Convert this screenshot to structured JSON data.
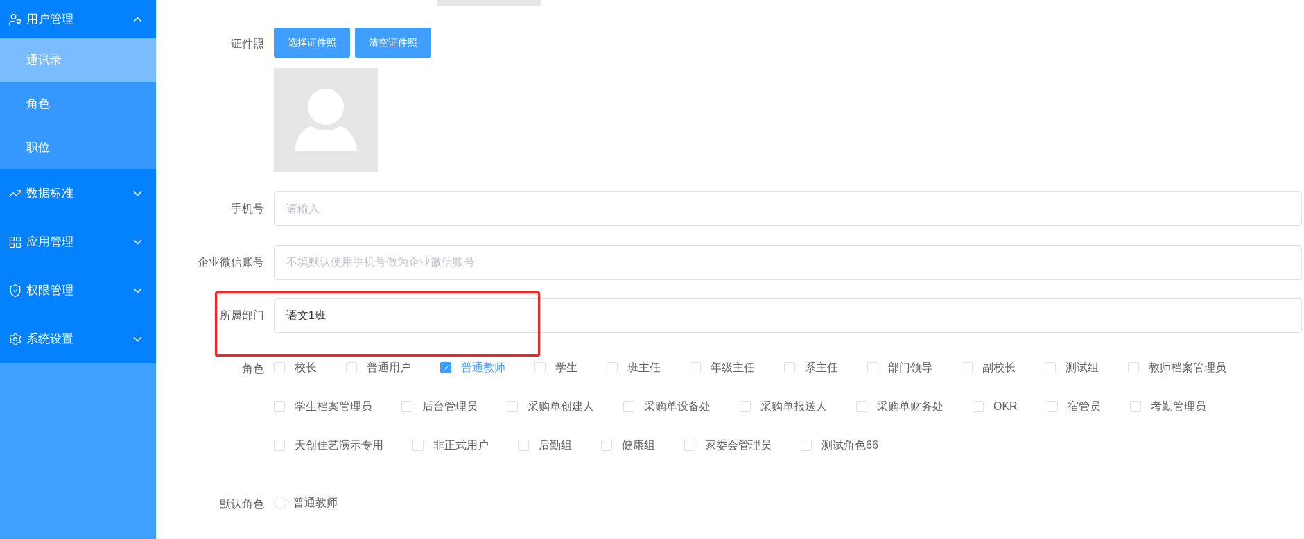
{
  "sidebar": {
    "items": [
      {
        "label": "用户管理",
        "expanded": true,
        "children": [
          {
            "label": "通讯录",
            "selected": true
          },
          {
            "label": "角色",
            "selected": false
          },
          {
            "label": "职位",
            "selected": false
          }
        ]
      },
      {
        "label": "数据标准",
        "expanded": false
      },
      {
        "label": "应用管理",
        "expanded": false
      },
      {
        "label": "权限管理",
        "expanded": false
      },
      {
        "label": "系统设置",
        "expanded": false
      }
    ]
  },
  "form": {
    "photo": {
      "label": "证件照",
      "buttons": [
        "选择证件照",
        "清空证件照"
      ]
    },
    "fields": [
      {
        "label": "手机号",
        "placeholder": "请输入"
      },
      {
        "label": "企业微信账号",
        "placeholder": "不填默认使用手机号做为企业微信账号"
      },
      {
        "label": "所属部门",
        "required": true,
        "value": "语文1班"
      }
    ],
    "roles": {
      "label": "角色",
      "options": [
        {
          "label": "校长",
          "checked": false
        },
        {
          "label": "普通用户",
          "checked": false
        },
        {
          "label": "普通教师",
          "checked": true
        },
        {
          "label": "学生",
          "checked": false
        },
        {
          "label": "班主任",
          "checked": false
        },
        {
          "label": "年级主任",
          "checked": false
        },
        {
          "label": "系主任",
          "checked": false
        },
        {
          "label": "部门领导",
          "checked": false
        },
        {
          "label": "副校长",
          "checked": false
        },
        {
          "label": "测试组",
          "checked": false
        },
        {
          "label": "教师档案管理员",
          "checked": false
        },
        {
          "label": "学生档案管理员",
          "checked": false
        },
        {
          "label": "后台管理员",
          "checked": false
        },
        {
          "label": "采购单创建人",
          "checked": false
        },
        {
          "label": "采购单设备处",
          "checked": false
        },
        {
          "label": "采购单报送人",
          "checked": false
        },
        {
          "label": "采购单财务处",
          "checked": false
        },
        {
          "label": "OKR",
          "checked": false
        },
        {
          "label": "宿管员",
          "checked": false
        },
        {
          "label": "考勤管理员",
          "checked": false
        },
        {
          "label": "天创佳艺演示专用",
          "checked": false
        },
        {
          "label": "非正式用户",
          "checked": false
        },
        {
          "label": "后勤组",
          "checked": false
        },
        {
          "label": "健康组",
          "checked": false
        },
        {
          "label": "家委会管理员",
          "checked": false
        },
        {
          "label": "测试角色66",
          "checked": false
        }
      ]
    },
    "default_role": {
      "label": "默认角色",
      "options": [
        {
          "label": "普通教师",
          "selected": false
        }
      ]
    }
  }
}
